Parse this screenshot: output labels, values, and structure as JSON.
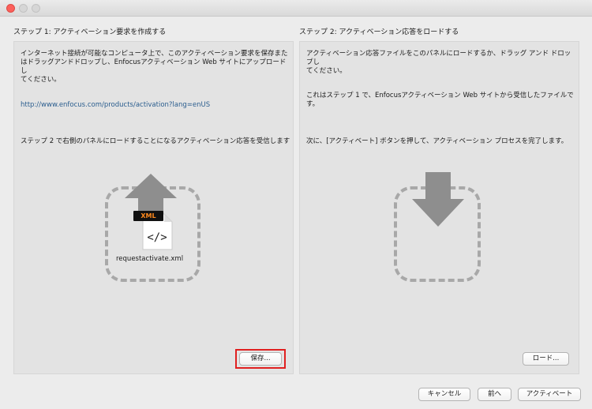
{
  "window": {
    "controls": [
      "close",
      "minimize",
      "zoom"
    ]
  },
  "step1": {
    "title": "ステップ 1: アクティベーション要求を作成する",
    "paragraph1_line1": "インターネット接続が可能なコンピュータ上で、このアクティベーション要求を保存また",
    "paragraph1_line2": "はドラッグアンドドロップし、Enfocusアクティベーション Web サイトにアップロードし",
    "paragraph1_line3": "てください。",
    "link": "http://www.enfocus.com/products/activation?lang=enUS",
    "paragraph2": "ステップ 2 で右側のパネルにロードすることになるアクティベーション応答を受信します",
    "file_badge": "XML",
    "file_icon": "code-file-icon",
    "file_name": "requestactivate.xml",
    "save_button": "保存..."
  },
  "step2": {
    "title": "ステップ 2: アクティベーション応答をロードする",
    "paragraph1_line1": "アクティベーション応答ファイルをこのパネルにロードするか、ドラッグ アンド ドロップし",
    "paragraph1_line2": "てください。",
    "paragraph2_line1": "これはステップ 1 で、Enfocusアクティベーション Web サイトから受信したファイルで",
    "paragraph2_line2": "す。",
    "paragraph3": "次に、[アクティベート] ボタンを押して、アクティベーション プロセスを完了します。",
    "load_button": "ロード..."
  },
  "footer": {
    "cancel_button": "キャンセル",
    "back_button": "前へ",
    "activate_button": "アクティベート"
  },
  "colors": {
    "link": "#2a5d8e",
    "highlight": "#e02020",
    "close_light": "#fc605b"
  }
}
